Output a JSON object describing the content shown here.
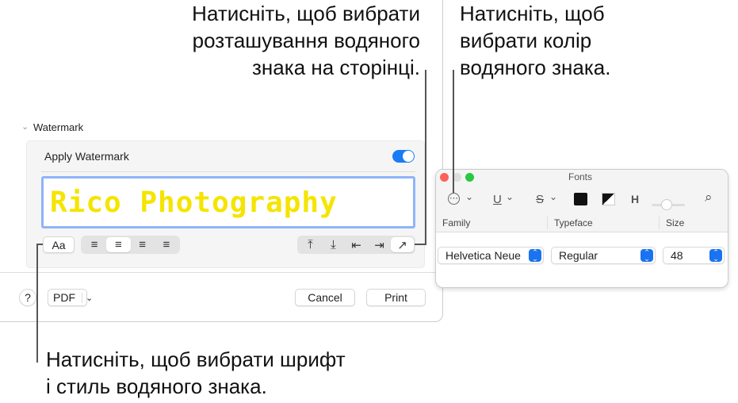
{
  "callouts": {
    "position": [
      "Натисніть, щоб вибрати",
      "розташування водяного",
      "знака на сторінці."
    ],
    "color": [
      "Натисніть, щоб",
      "вибрати колір",
      "водяного знака."
    ],
    "font": [
      "Натисніть, щоб вибрати шрифт",
      "і стиль водяного знака."
    ]
  },
  "watermark": {
    "section_title": "Watermark",
    "apply_label": "Apply Watermark",
    "apply_on": true,
    "text": "Rico Photography",
    "text_color": "#f5e400",
    "font_button": "Aa",
    "align_icons": [
      "≡",
      "≡",
      "≡",
      "≡"
    ],
    "position_icons": [
      "⤒",
      "⤓",
      "⇤",
      "⇥",
      "↗"
    ]
  },
  "footer": {
    "help": "?",
    "pdf": "PDF",
    "pdf_chevron": "⌄",
    "cancel": "Cancel",
    "print": "Print"
  },
  "fonts": {
    "title": "Fonts",
    "headers": [
      "Family",
      "Typeface",
      "Size"
    ],
    "family": "Helvetica Neue",
    "typeface": "Regular",
    "size": "48",
    "toolbar": {
      "more": "⋯",
      "underline": "U",
      "strike": "S",
      "chev": "⌄",
      "spacing": "H",
      "search": "⌕"
    }
  }
}
